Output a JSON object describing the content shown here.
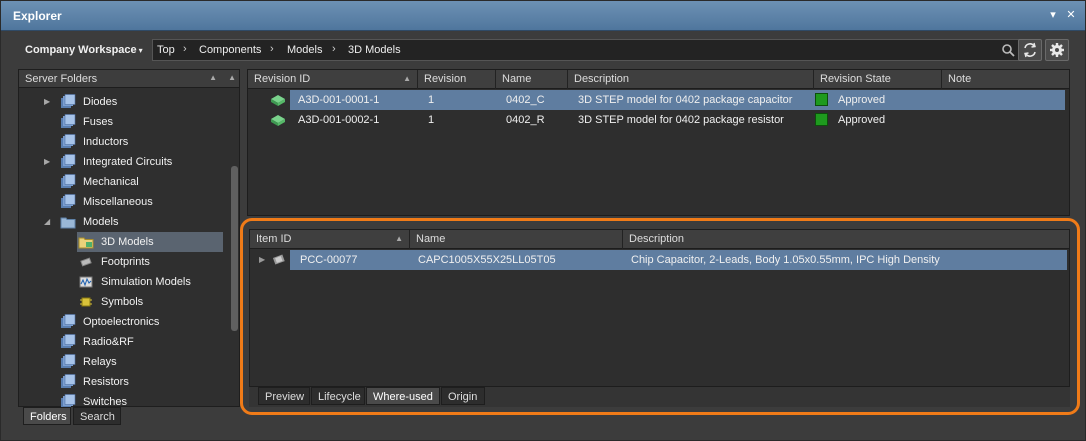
{
  "window": {
    "title": "Explorer",
    "pin_glyph": "▾",
    "close_glyph": "✕"
  },
  "toolbar": {
    "workspace": "Company Workspace",
    "workspace_arrow": "▾",
    "breadcrumbs": [
      "Top",
      "Components",
      "Models",
      "3D Models"
    ],
    "breadcrumb_sep": "›"
  },
  "sidebar": {
    "header": "Server Folders",
    "items": [
      {
        "label": "Diodes",
        "expander": "▶",
        "level": 0,
        "icon": "folder-stack-icon"
      },
      {
        "label": "Fuses",
        "expander": "",
        "level": 0,
        "icon": "folder-stack-icon"
      },
      {
        "label": "Inductors",
        "expander": "",
        "level": 0,
        "icon": "folder-stack-icon"
      },
      {
        "label": "Integrated Circuits",
        "expander": "▶",
        "level": 0,
        "icon": "folder-stack-icon"
      },
      {
        "label": "Mechanical",
        "expander": "",
        "level": 0,
        "icon": "folder-stack-icon"
      },
      {
        "label": "Miscellaneous",
        "expander": "",
        "level": 0,
        "icon": "folder-stack-icon"
      },
      {
        "label": "Models",
        "expander": "◢",
        "level": 0,
        "icon": "folder-icon"
      },
      {
        "label": "3D Models",
        "expander": "",
        "level": 1,
        "icon": "folder-3d-icon",
        "selected": true
      },
      {
        "label": "Footprints",
        "expander": "",
        "level": 1,
        "icon": "footprint-icon"
      },
      {
        "label": "Simulation Models",
        "expander": "",
        "level": 1,
        "icon": "simulation-icon"
      },
      {
        "label": "Symbols",
        "expander": "",
        "level": 1,
        "icon": "symbol-icon"
      },
      {
        "label": "Optoelectronics",
        "expander": "",
        "level": 0,
        "icon": "folder-stack-icon"
      },
      {
        "label": "Radio&RF",
        "expander": "",
        "level": 0,
        "icon": "folder-stack-icon"
      },
      {
        "label": "Relays",
        "expander": "",
        "level": 0,
        "icon": "folder-stack-icon"
      },
      {
        "label": "Resistors",
        "expander": "",
        "level": 0,
        "icon": "folder-stack-icon"
      },
      {
        "label": "Switches",
        "expander": "",
        "level": 0,
        "icon": "folder-stack-icon"
      }
    ],
    "tabs": [
      "Folders",
      "Search"
    ]
  },
  "upper_grid": {
    "columns": [
      "Revision ID",
      "Revision",
      "Name",
      "Description",
      "Revision State",
      "Note"
    ],
    "rows": [
      {
        "revision_id": "A3D-001-0001-1",
        "revision": "1",
        "name": "0402_C",
        "description": "3D STEP model for 0402 package capacitor",
        "state": "Approved",
        "selected": true
      },
      {
        "revision_id": "A3D-001-0002-1",
        "revision": "1",
        "name": "0402_R",
        "description": "3D STEP model for 0402 package resistor",
        "state": "Approved",
        "selected": false
      }
    ]
  },
  "lower_grid": {
    "columns": [
      "Item ID",
      "Name",
      "Description"
    ],
    "rows": [
      {
        "item_id": "PCC-00077",
        "name": "CAPC1005X55X25LL05T05",
        "description": "Chip Capacitor, 2-Leads, Body 1.05x0.55mm, IPC High Density",
        "selected": true
      }
    ],
    "tabs": [
      "Preview",
      "Lifecycle",
      "Where-used",
      "Origin"
    ],
    "active_tab": "Where-used"
  },
  "colors": {
    "accent_highlight": "#f07b18",
    "title_bar": "#5b82a8",
    "selection": "#5f7da0",
    "approved": "#1e9a1e"
  }
}
